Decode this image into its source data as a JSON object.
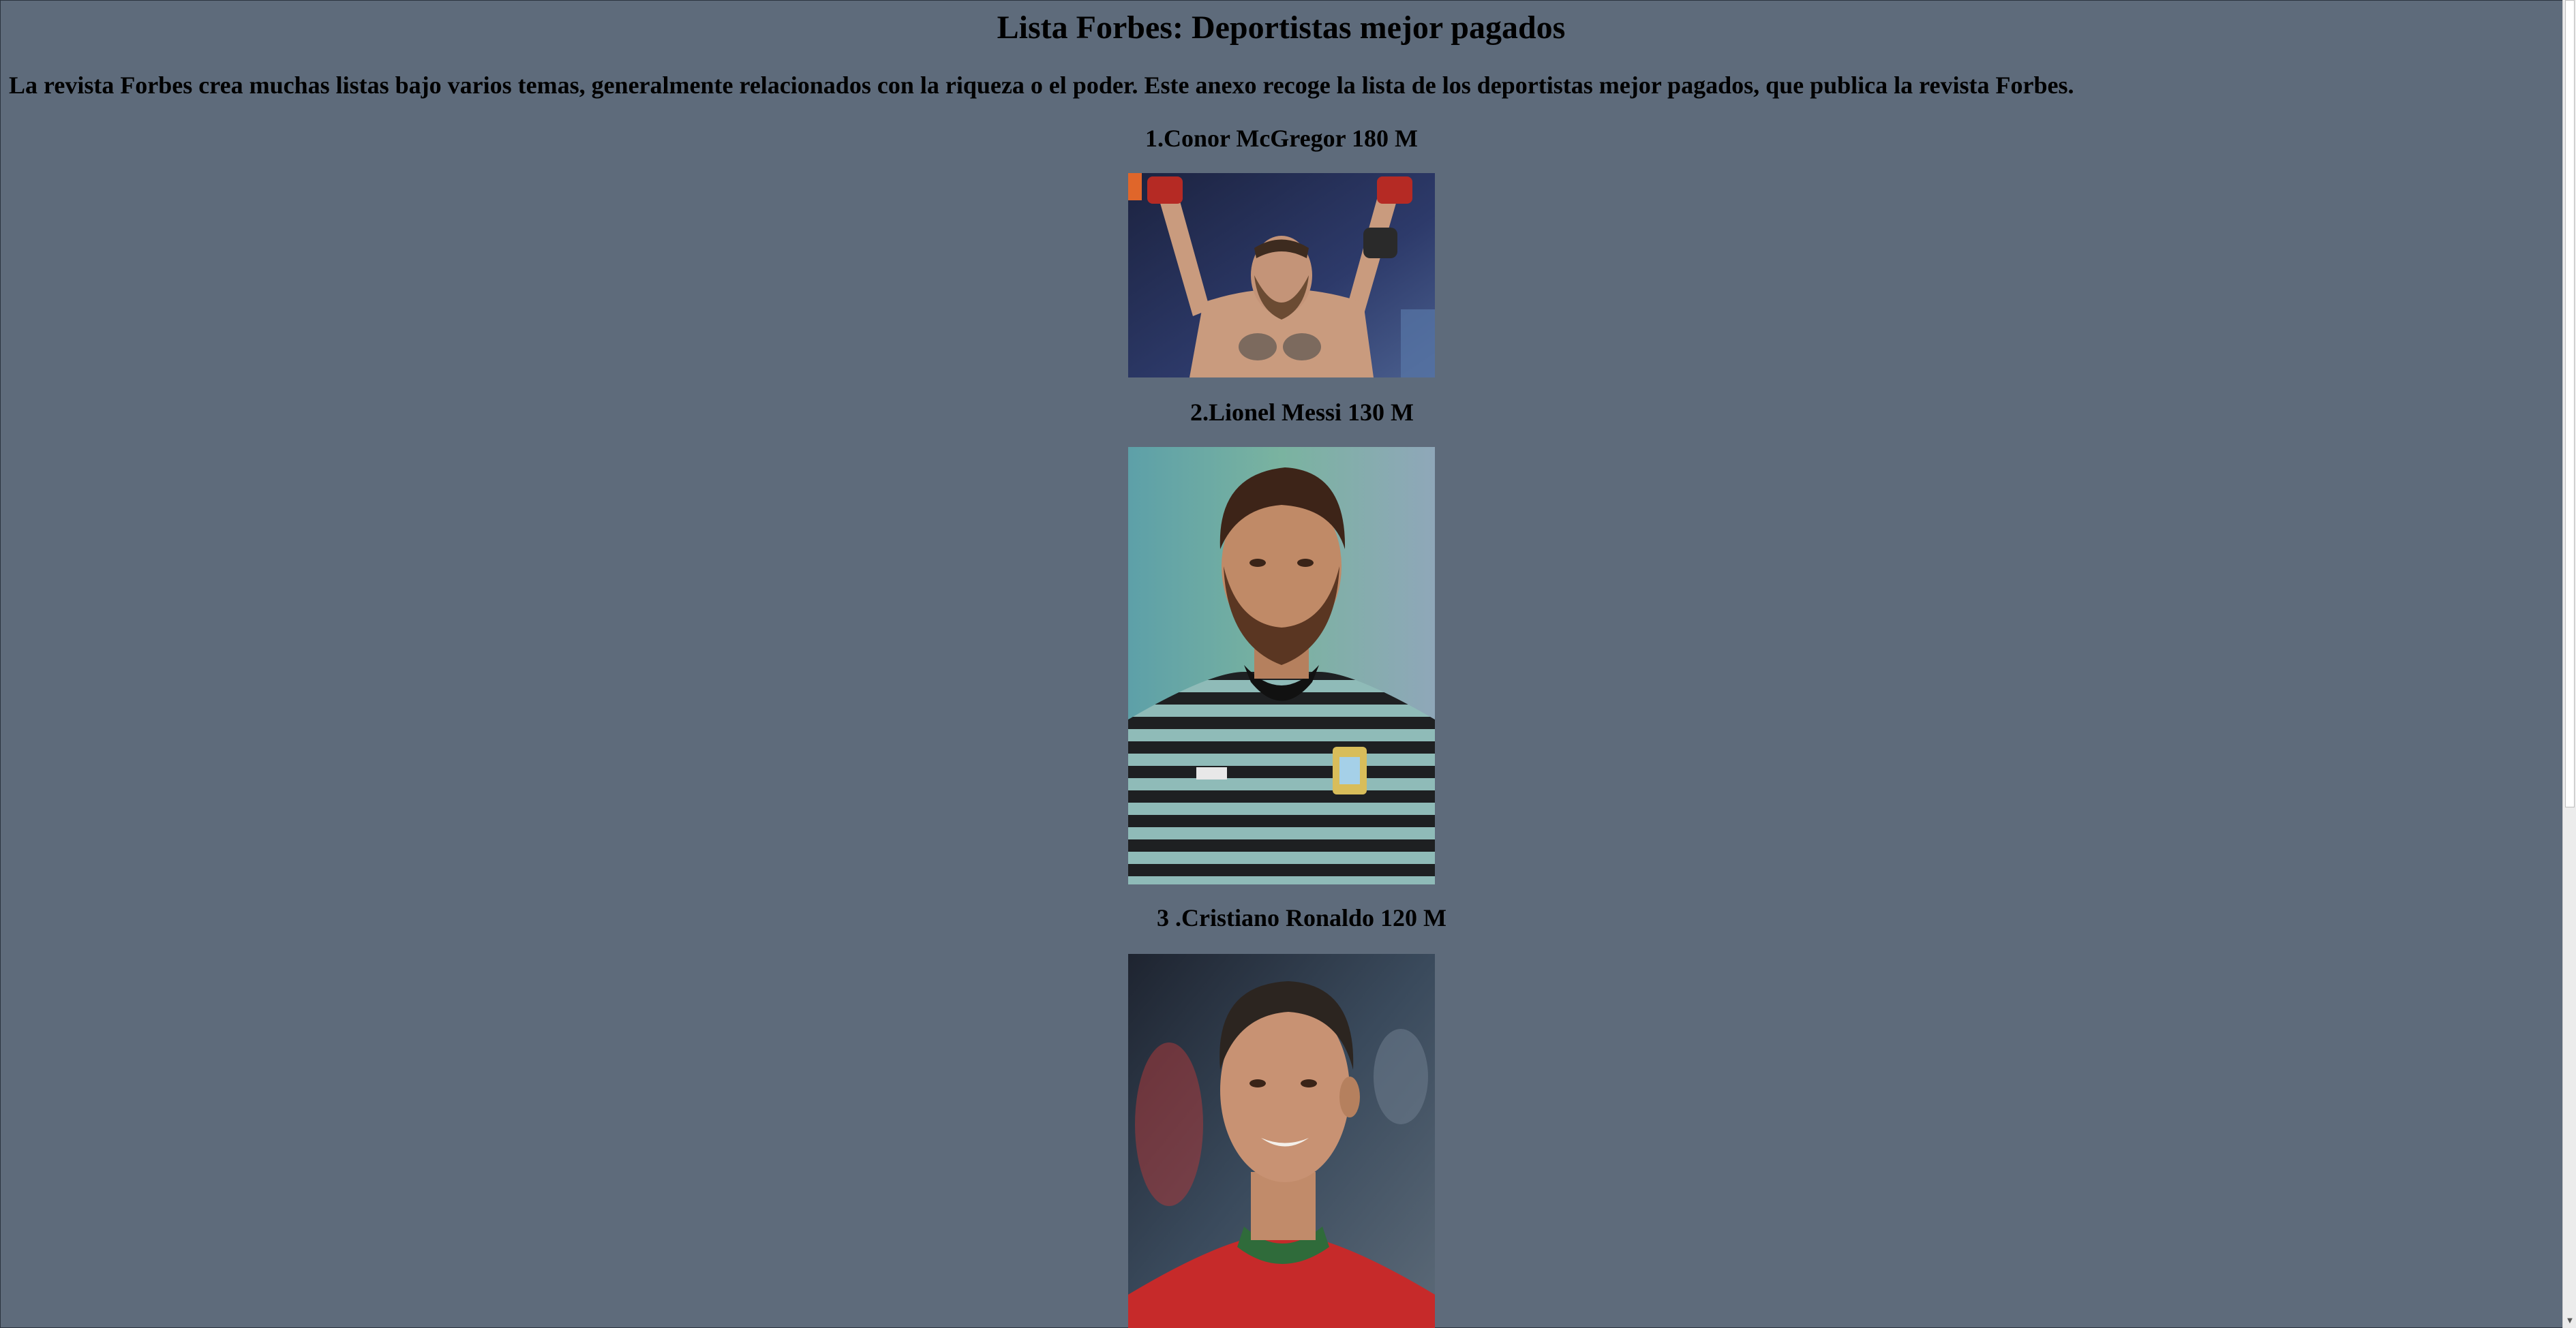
{
  "page": {
    "title": "Lista Forbes: Deportistas mejor pagados",
    "intro": "La revista Forbes crea muchas listas bajo varios temas, generalmente relacionados con la riqueza o el poder. Este anexo recoge la lista de los deportistas mejor pagados, que publica la revista Forbes."
  },
  "athletes": [
    {
      "heading": "1.Conor McGregor 180 M",
      "photo_icon": "athlete-photo"
    },
    {
      "heading": "2.Lionel Messi 130 M",
      "photo_icon": "athlete-photo"
    },
    {
      "heading": "3 .Cristiano Ronaldo 120 M",
      "photo_icon": "athlete-photo"
    }
  ],
  "colors": {
    "background": "#5e6b7b",
    "text": "#000000"
  }
}
